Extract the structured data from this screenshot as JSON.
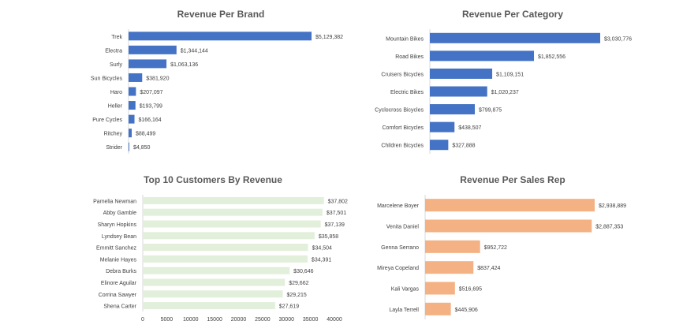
{
  "chart_data": [
    {
      "type": "bar",
      "orientation": "horizontal",
      "title": "Revenue Per Brand",
      "categories": [
        "Trek",
        "Electra",
        "Surly",
        "Sun Bicycles",
        "Haro",
        "Heller",
        "Pure Cycles",
        "Ritchey",
        "Strider"
      ],
      "values": [
        5129382,
        1344144,
        1063136,
        381920,
        207097,
        193799,
        166164,
        88499,
        4850
      ],
      "value_labels": [
        "$5,129,382",
        "$1,344,144",
        "$1,063,136",
        "$381,920",
        "$207,097",
        "$193,799",
        "$166,164",
        "$88,499",
        "$4,850"
      ],
      "color": "#4472c4",
      "grid": false,
      "legend": "none"
    },
    {
      "type": "bar",
      "orientation": "horizontal",
      "title": "Revenue Per Category",
      "categories": [
        "Mountain Bikes",
        "Road Bikes",
        "Cruisers Bicycles",
        "Electric Bikes",
        "Cyclocross Bicycles",
        "Comfort Bicycles",
        "Children Bicycles"
      ],
      "values": [
        3030776,
        1852556,
        1109151,
        1020237,
        799875,
        438507,
        327888
      ],
      "value_labels": [
        "$3,030,776",
        "$1,852,556",
        "$1,109,151",
        "$1,020,237",
        "$799,875",
        "$438,507",
        "$327,888"
      ],
      "color": "#4472c4",
      "grid": false,
      "legend": "none"
    },
    {
      "type": "bar",
      "orientation": "horizontal",
      "title": "Top 10 Customers By Revenue",
      "categories": [
        "Pamelia Newman",
        "Abby Gamble",
        "Sharyn Hopkins",
        "Lyndsey Bean",
        "Emmitt Sanchez",
        "Melanie Hayes",
        "Debra Burks",
        "Elinore Aguilar",
        "Corrina Sawyer",
        "Shena Carter"
      ],
      "values": [
        37802,
        37501,
        37139,
        35858,
        34504,
        34391,
        30646,
        29662,
        29215,
        27619
      ],
      "value_labels": [
        "$37,802",
        "$37,501",
        "$37,139",
        "$35,858",
        "$34,504",
        "$34,391",
        "$30,646",
        "$29,662",
        "$29,215",
        "$27,619"
      ],
      "xlim": [
        0,
        40000
      ],
      "x_ticks": [
        "0",
        "5000",
        "10000",
        "15000",
        "20000",
        "25000",
        "30000",
        "35000",
        "40000"
      ],
      "color": "#e2efda",
      "grid": false,
      "legend": "none"
    },
    {
      "type": "bar",
      "orientation": "horizontal",
      "title": "Revenue Per Sales Rep",
      "categories": [
        "Marcelene Boyer",
        "Venita Daniel",
        "Genna Serrano",
        "Mireya Copeland",
        "Kali Vargas",
        "Layla Terrell"
      ],
      "values": [
        2938889,
        2887353,
        952722,
        837424,
        516695,
        445906
      ],
      "value_labels": [
        "$2,938,889",
        "$2,887,353",
        "$952,722",
        "$837,424",
        "$516,695",
        "$445,906"
      ],
      "color": "#f4b183",
      "grid": false,
      "legend": "none"
    }
  ]
}
